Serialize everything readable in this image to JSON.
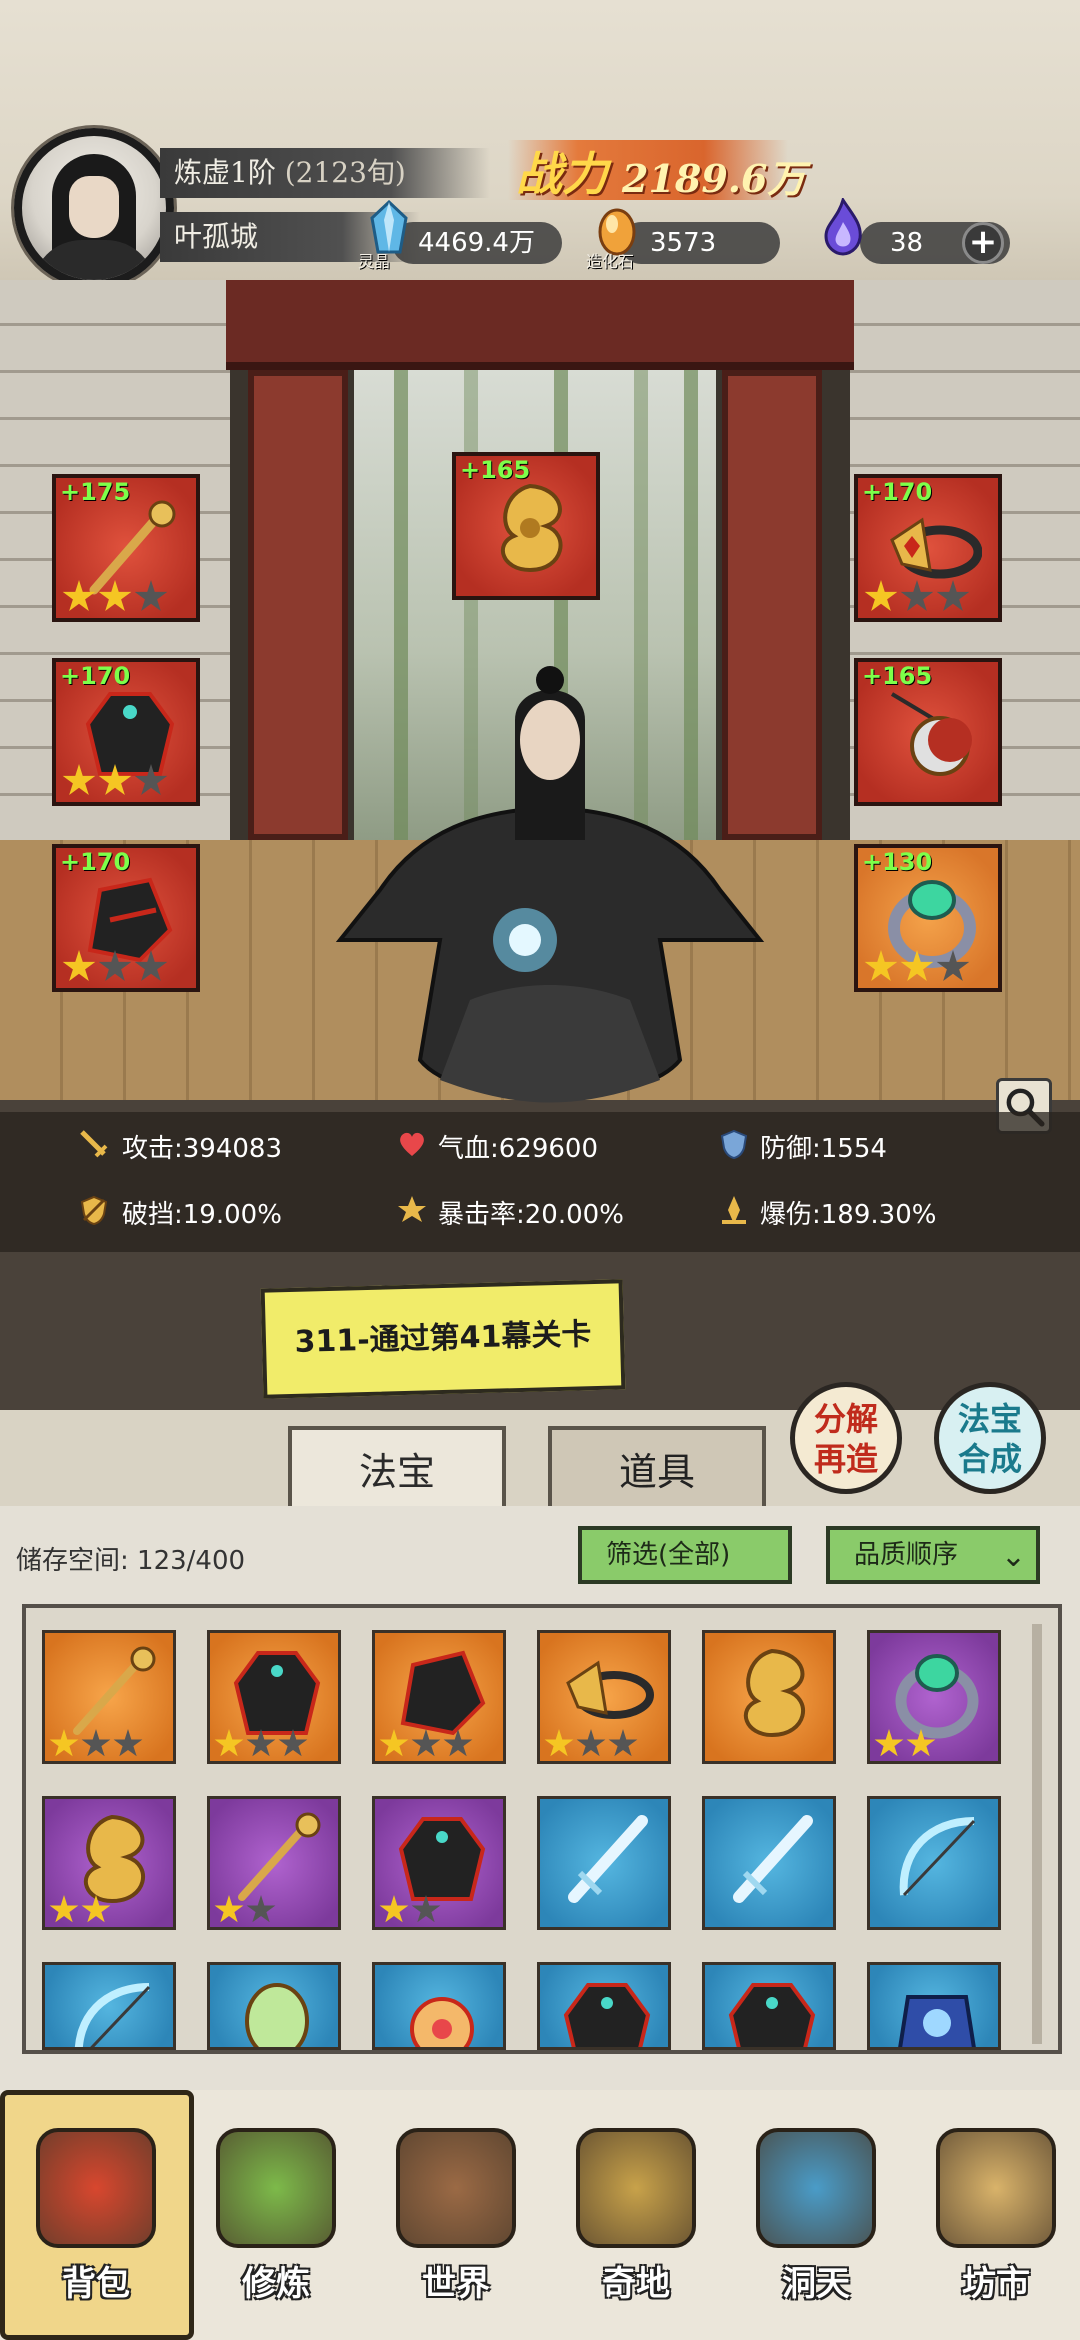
{
  "header": {
    "realm": "炼虚1阶",
    "realm_sub": "(2123旬)",
    "player_name": "叶孤城",
    "power_label": "战力",
    "power_value": "2189.6万",
    "resources": [
      {
        "icon": "spirit-crystal-icon",
        "caption": "灵晶",
        "value": "4469.4万",
        "color": "#5fb7e6"
      },
      {
        "icon": "creation-stone-icon",
        "caption": "造化石",
        "value": "3573",
        "color": "#f0a23a"
      },
      {
        "icon": "purple-flame-icon",
        "caption": "",
        "value": "38",
        "color": "#6a4cd8"
      }
    ],
    "plus_label": "+"
  },
  "equipment": [
    {
      "bonus": "+175",
      "item": "golden-staff-icon",
      "stars": 2,
      "frame": "red"
    },
    {
      "bonus": "+165",
      "item": "golden-dragon-icon",
      "stars": 0,
      "frame": "red"
    },
    {
      "bonus": "+170",
      "item": "golden-headband-icon",
      "stars": 1,
      "frame": "red"
    },
    {
      "bonus": "+170",
      "item": "dark-robe-icon",
      "stars": 2,
      "frame": "red"
    },
    {
      "bonus": "+165",
      "item": "moon-pendant-icon",
      "stars": 0,
      "frame": "red"
    },
    {
      "bonus": "+170",
      "item": "dark-boots-icon",
      "stars": 1,
      "frame": "red"
    },
    {
      "bonus": "+130",
      "item": "jade-ring-icon",
      "stars": 2,
      "frame": "orange"
    }
  ],
  "stats": {
    "attack_label": "攻击:",
    "attack": "394083",
    "hp_label": "气血:",
    "hp": "629600",
    "defense_label": "防御:",
    "defense": "1554",
    "pierce_label": "破挡:",
    "pierce": "19.00%",
    "crit_label": "暴击率:",
    "crit": "20.00%",
    "critdmg_label": "爆伤:",
    "critdmg": "189.30%"
  },
  "quest": {
    "label": "311-通过第41幕关卡"
  },
  "actions": {
    "decompose_l1": "分解",
    "decompose_l2": "再造",
    "synth_l1": "法宝",
    "synth_l2": "合成"
  },
  "tabs": [
    {
      "label": "法宝",
      "active": true
    },
    {
      "label": "道具",
      "active": false
    }
  ],
  "inventory": {
    "storage_label": "储存空间:",
    "storage_value": "123/400",
    "filter_label": "筛选(全部)",
    "sort_label": "品质顺序",
    "items": [
      {
        "item": "golden-staff-icon",
        "frame": "orange",
        "stars": 1,
        "max_stars": 3
      },
      {
        "item": "dark-robe-icon",
        "frame": "orange",
        "stars": 1,
        "max_stars": 3
      },
      {
        "item": "dark-boots-icon",
        "frame": "orange",
        "stars": 1,
        "max_stars": 3
      },
      {
        "item": "golden-headband-icon",
        "frame": "orange",
        "stars": 1,
        "max_stars": 3
      },
      {
        "item": "golden-dragon-icon",
        "frame": "orange",
        "stars": 0,
        "max_stars": 0
      },
      {
        "item": "jade-ring-icon",
        "frame": "purple",
        "stars": 2,
        "max_stars": 2
      },
      {
        "item": "golden-dragon-icon",
        "frame": "purple",
        "stars": 2,
        "max_stars": 2
      },
      {
        "item": "golden-staff-icon",
        "frame": "purple",
        "stars": 1,
        "max_stars": 2
      },
      {
        "item": "dark-robe-icon",
        "frame": "purple",
        "stars": 1,
        "max_stars": 2
      },
      {
        "item": "ice-sword-icon",
        "frame": "blue",
        "stars": 0,
        "max_stars": 0
      },
      {
        "item": "ice-sword-icon",
        "frame": "blue",
        "stars": 0,
        "max_stars": 0
      },
      {
        "item": "ice-bow-icon",
        "frame": "blue",
        "stars": 0,
        "max_stars": 0
      },
      {
        "item": "ice-bow-icon",
        "frame": "blue",
        "stars": 0,
        "max_stars": 0
      },
      {
        "item": "jade-mirror-icon",
        "frame": "blue",
        "stars": 0,
        "max_stars": 0
      },
      {
        "item": "flower-crown-icon",
        "frame": "blue",
        "stars": 0,
        "max_stars": 0
      },
      {
        "item": "dark-robe-icon",
        "frame": "blue",
        "stars": 0,
        "max_stars": 0
      },
      {
        "item": "dark-robe-icon",
        "frame": "blue",
        "stars": 0,
        "max_stars": 0
      },
      {
        "item": "blue-armor-icon",
        "frame": "blue",
        "stars": 0,
        "max_stars": 0
      }
    ]
  },
  "nav": [
    {
      "label": "背包",
      "icon": "bag-icon",
      "color": "#d8472e",
      "active": true
    },
    {
      "label": "修炼",
      "icon": "lotus-icon",
      "color": "#7dba4a",
      "active": false
    },
    {
      "label": "世界",
      "icon": "scroll-map-icon",
      "color": "#9b6a45",
      "active": false
    },
    {
      "label": "奇地",
      "icon": "pagoda-icon",
      "color": "#c8a24a",
      "active": false
    },
    {
      "label": "洞天",
      "icon": "portal-icon",
      "color": "#4a9cc8",
      "active": false
    },
    {
      "label": "坊市",
      "icon": "market-stall-icon",
      "color": "#d9b36a",
      "active": false
    }
  ]
}
